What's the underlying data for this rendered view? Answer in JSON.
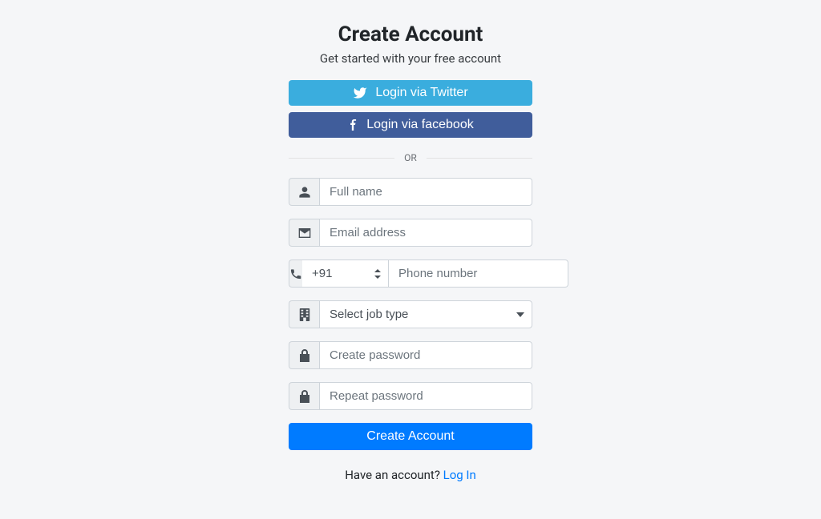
{
  "heading": "Create Account",
  "subheading": "Get started with your free account",
  "social": {
    "twitter_label": "Login via Twitter",
    "facebook_label": "Login via facebook"
  },
  "divider_text": "OR",
  "placeholders": {
    "full_name": "Full name",
    "email": "Email address",
    "phone": "Phone number",
    "create_password": "Create password",
    "repeat_password": "Repeat password"
  },
  "country_code_selected": "+91",
  "job_type_selected": "Select job type",
  "submit_label": "Create Account",
  "footer": {
    "prefix": "Have an account? ",
    "link_label": "Log In"
  },
  "colors": {
    "twitter": "#3aadde",
    "facebook": "#405d9b",
    "primary": "#007bff"
  }
}
